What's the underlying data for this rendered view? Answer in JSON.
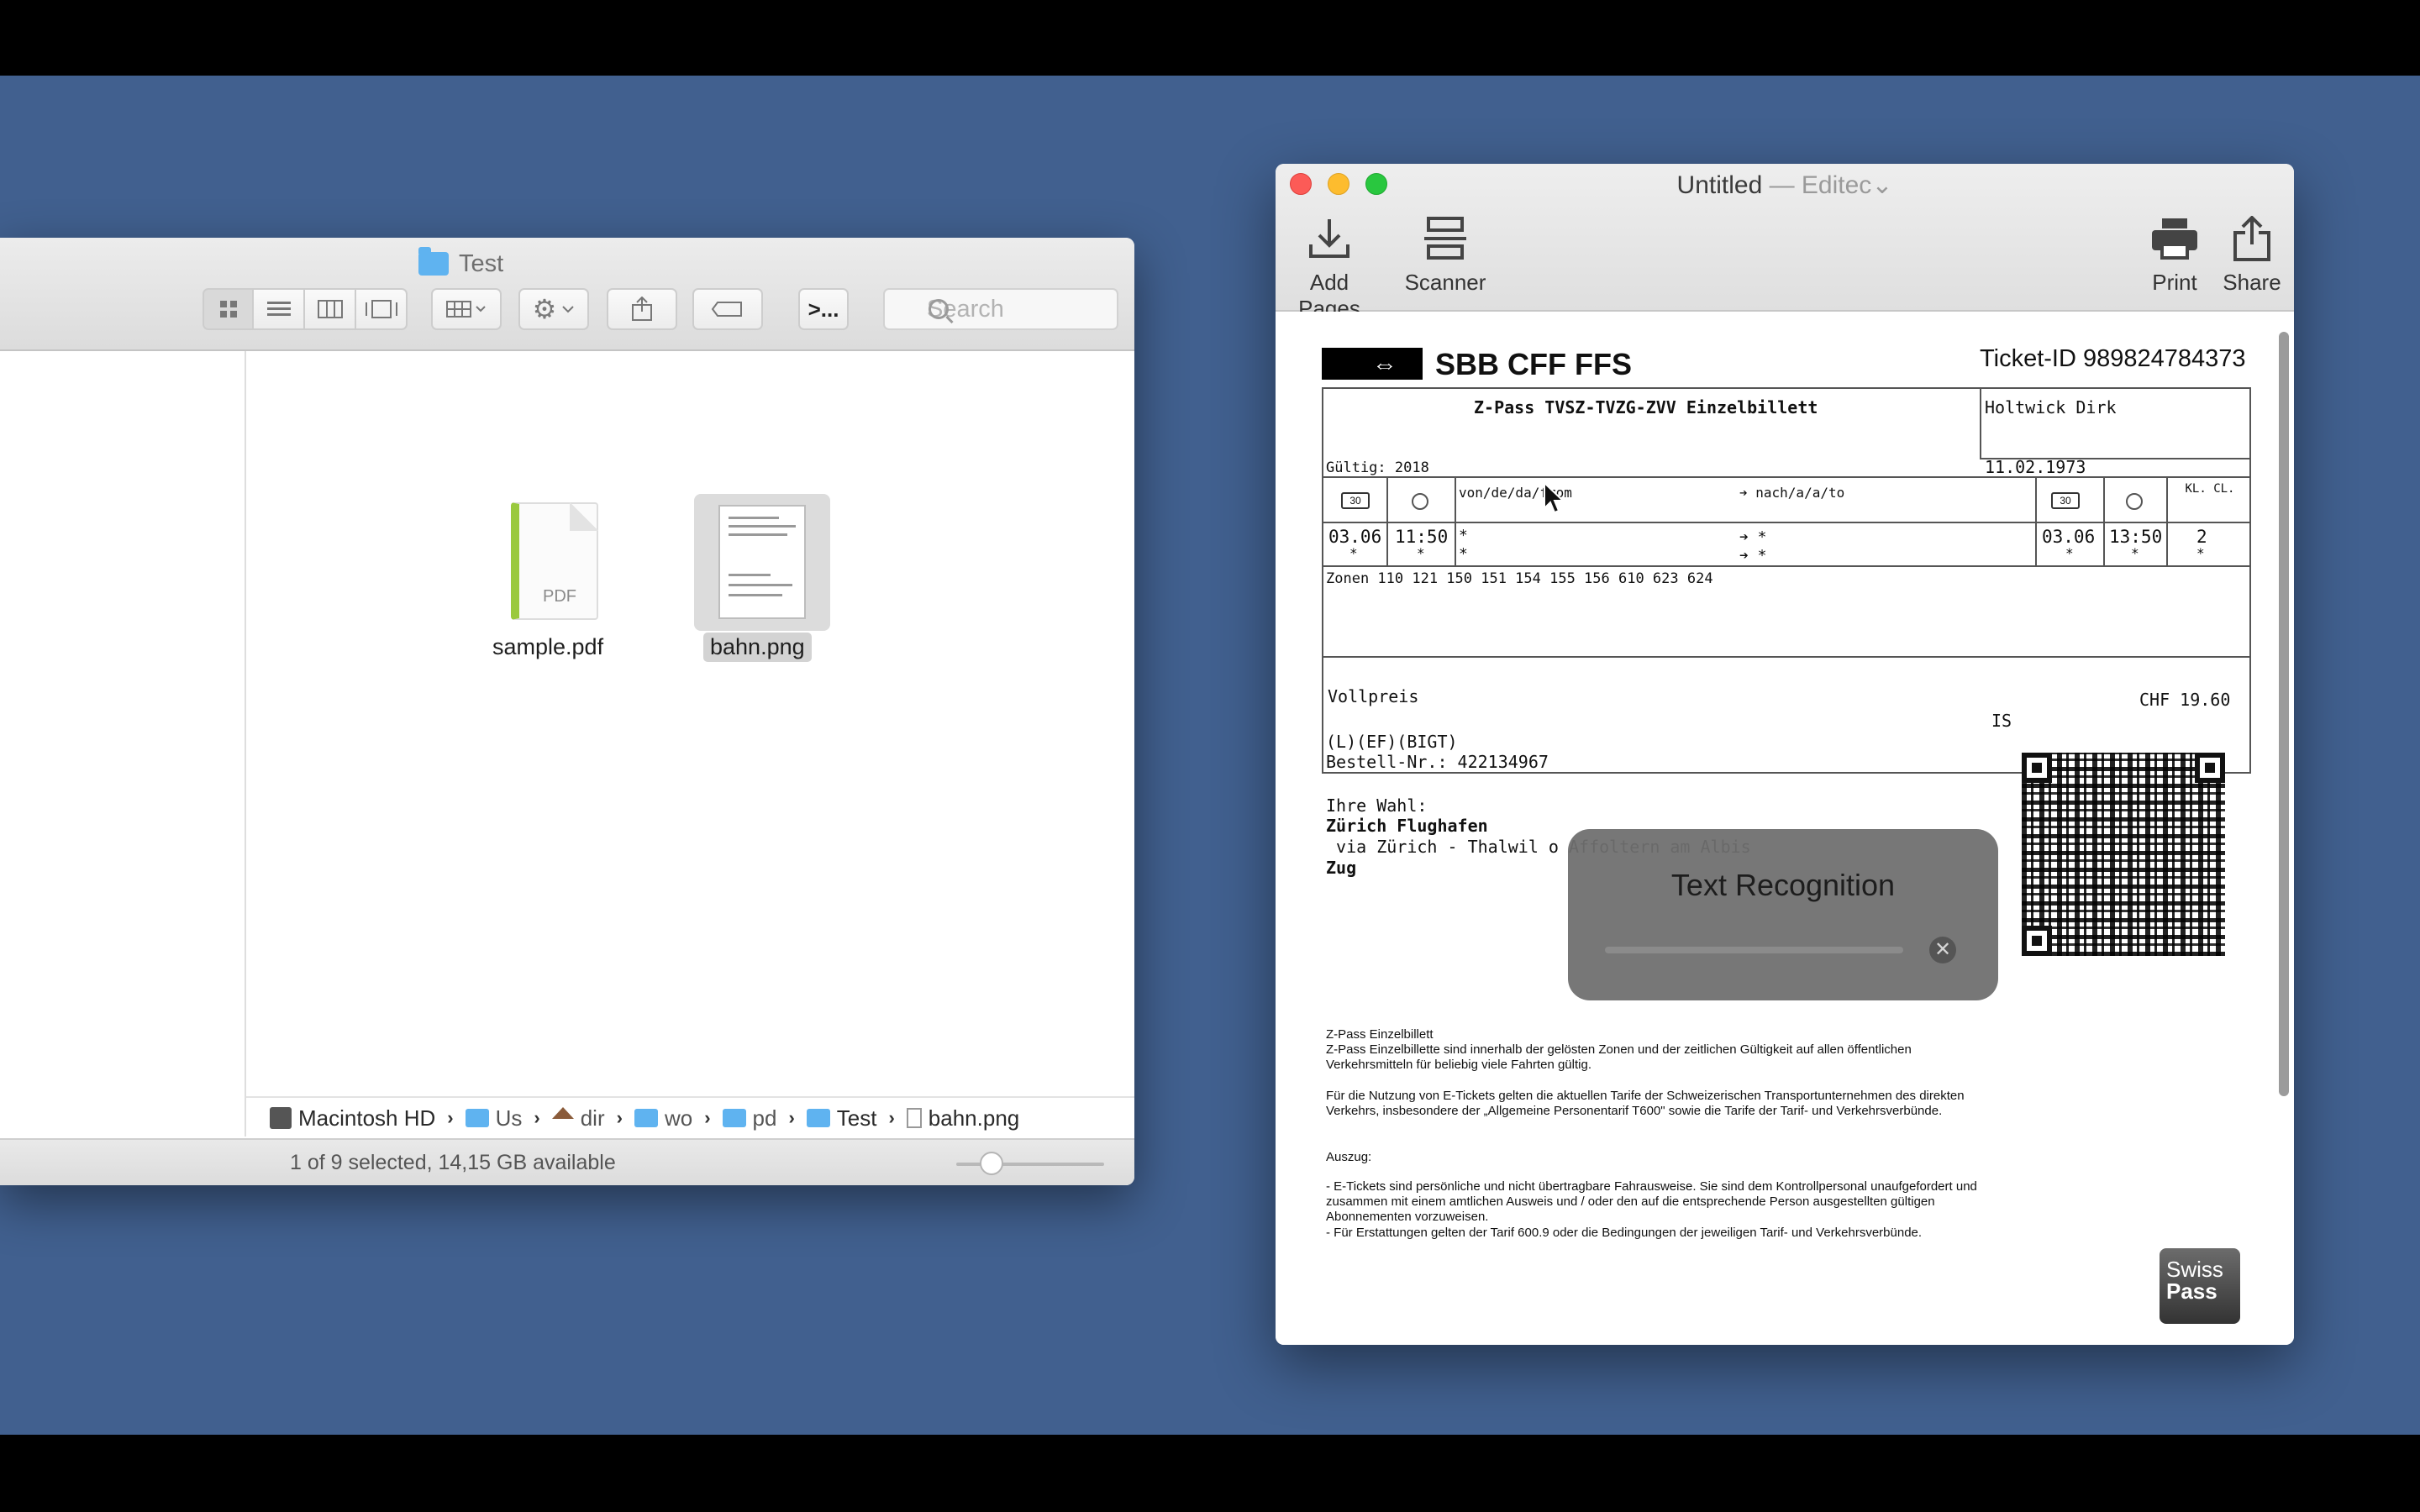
{
  "finder": {
    "title": "Test",
    "search_placeholder": "Search",
    "terminal_label": ">...",
    "files": [
      {
        "name": "sample.pdf",
        "badge": "PDF"
      },
      {
        "name": "bahn.png"
      }
    ],
    "path": [
      {
        "label": "Macintosh HD"
      },
      {
        "label": "Us"
      },
      {
        "label": "dir"
      },
      {
        "label": "wo"
      },
      {
        "label": "pd"
      },
      {
        "label": "Test"
      },
      {
        "label": "bahn.png"
      }
    ],
    "path_separator": "›",
    "status": "1 of 9 selected, 14,15 GB available"
  },
  "editor": {
    "title_main": "Untitled",
    "title_sep": " — ",
    "title_app": "Editec",
    "title_chevron": "⌄",
    "toolbar": {
      "add_pages": "Add Pages",
      "scanner": "Scanner",
      "print": "Print",
      "share": "Share"
    },
    "ticket": {
      "brand": "SBB CFF FFS",
      "ticket_id": "Ticket-ID 989824784373",
      "product": "Z-Pass TVSZ-TVZG-ZVV Einzelbillett",
      "holder": "Holtwick Dirk",
      "valid": "Gültig: 2018",
      "birthdate": "11.02.1973",
      "cal_icon_label": "30",
      "from_label": "von/de/da/from",
      "to_label": "➔ nach/a/a/to",
      "class_label": "KL. CL.",
      "dep_date": "03.06",
      "dep_time": "11:50",
      "arr_date": "03.06",
      "arr_time": "13:50",
      "class_value": "2",
      "star": "*",
      "arrow_star": "➔ *",
      "zones": "Zonen 110 121 150 151 154 155 156 610 623 624",
      "fare": "Vollpreis",
      "fare_partial": "IS",
      "price": "CHF 19.60",
      "codes": "(L)(EF)(BIGT)",
      "order_no": "Bestell-Nr.: 422134967",
      "choice_label": "Ihre Wahl:",
      "dest_from": "Zürich Flughafen",
      "via": " via Zürich - Thalwil o Affoltern am Albis",
      "dest_to": "Zug",
      "fine_title": "Z-Pass Einzelbillett",
      "fine_1": "Z-Pass Einzelbillette sind innerhalb der gelösten Zonen und der zeitlichen Gültigkeit auf allen öffentlichen Verkehrsmitteln für beliebig viele Fahrten gültig.",
      "fine_2": "Für die Nutzung von E-Tickets gelten die aktuellen Tarife der Schweizerischen Transportunternehmen des direkten Verkehrs, insbesondere der „Allgemeine Personentarif T600\" sowie die Tarife der Tarif- und Verkehrsverbünde.",
      "fine_3": "Auszug:",
      "fine_4": "-   E-Tickets sind persönliche und nicht übertragbare Fahrausweise. Sie sind dem Kontrollpersonal unaufgefordert und zusammen mit einem amtlichen Ausweis und / oder den auf die entsprechende Person ausgestellten gültigen Abonnementen vorzuweisen.",
      "fine_5": "-   Für Erstattungen gelten der Tarif 600.9 oder die Bedingungen der jeweiligen Tarif- und Verkehrsverbünde.",
      "swisspass_1": "Swiss",
      "swisspass_2": "Pass"
    },
    "text_recognition": {
      "title": "Text Recognition",
      "progress": 0.0
    }
  },
  "icons": {
    "cancel": "✕",
    "gear": "⚙"
  }
}
